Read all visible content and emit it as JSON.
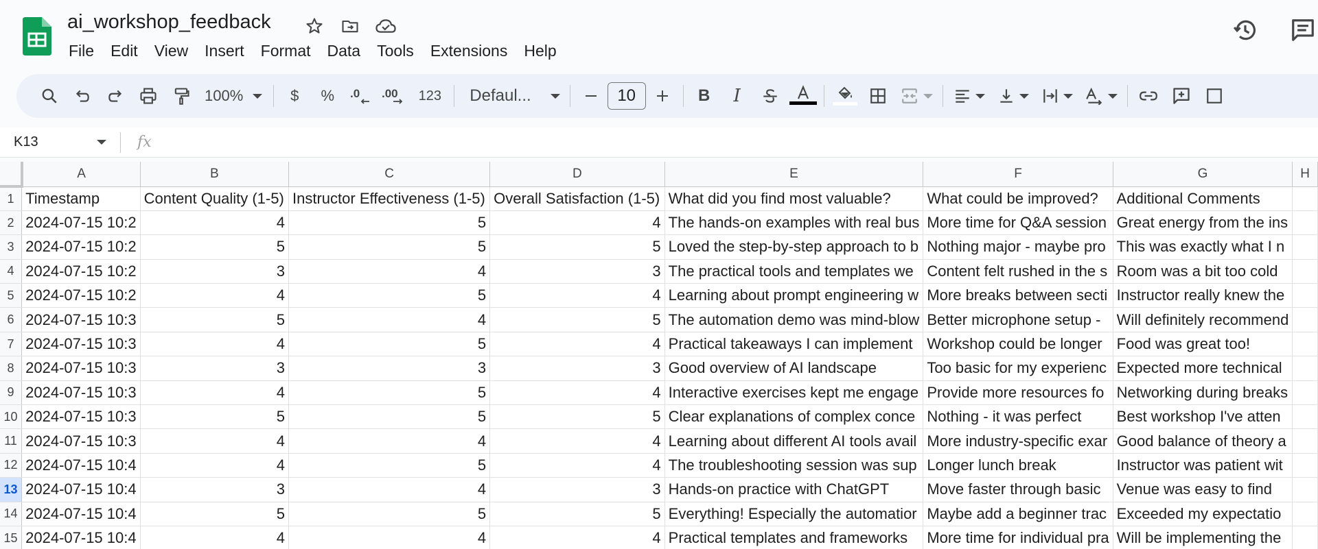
{
  "document": {
    "title": "ai_workshop_feedback"
  },
  "menu": [
    "File",
    "Edit",
    "View",
    "Insert",
    "Format",
    "Data",
    "Tools",
    "Extensions",
    "Help"
  ],
  "toolbar": {
    "zoom": "100%",
    "currency": "$",
    "percent": "%",
    "dec_decrease": ".0",
    "dec_increase": ".00",
    "number_format": "123",
    "font": "Defaul...",
    "font_size": "10",
    "bold": "B",
    "italic": "I"
  },
  "formula_bar": {
    "cell_ref": "K13",
    "fx": "fx",
    "value": ""
  },
  "sheet": {
    "columns": [
      "A",
      "B",
      "C",
      "D",
      "E",
      "F",
      "G",
      "H"
    ],
    "rows": [
      {
        "n": "1",
        "cells": [
          "Timestamp",
          "Content Quality (1-5)",
          "Instructor Effectiveness (1-5)",
          "Overall Satisfaction (1-5)",
          "What did you find most valuable?",
          "What could be improved?",
          "Additional Comments",
          ""
        ]
      },
      {
        "n": "2",
        "cells": [
          "2024-07-15 10:2",
          "4",
          "5",
          "4",
          "The hands-on examples with real bus",
          "More time for Q&A session",
          "Great energy from the ins",
          ""
        ]
      },
      {
        "n": "3",
        "cells": [
          "2024-07-15 10:2",
          "5",
          "5",
          "5",
          "Loved the step-by-step approach to b",
          "Nothing major - maybe pro",
          "This was exactly what I n",
          ""
        ]
      },
      {
        "n": "4",
        "cells": [
          "2024-07-15 10:2",
          "3",
          "4",
          "3",
          "The practical tools and templates we",
          "Content felt rushed in the s",
          "Room was a bit too cold",
          ""
        ]
      },
      {
        "n": "5",
        "cells": [
          "2024-07-15 10:2",
          "4",
          "5",
          "4",
          "Learning about prompt engineering w",
          "More breaks between secti",
          "Instructor really knew the",
          ""
        ]
      },
      {
        "n": "6",
        "cells": [
          "2024-07-15 10:3",
          "5",
          "4",
          "5",
          "The automation demo was mind-blow",
          "Better microphone setup -",
          "Will definitely recommend",
          ""
        ]
      },
      {
        "n": "7",
        "cells": [
          "2024-07-15 10:3",
          "4",
          "5",
          "4",
          "Practical takeaways I can implement",
          "Workshop could be longer",
          "Food was great too!",
          ""
        ]
      },
      {
        "n": "8",
        "cells": [
          "2024-07-15 10:3",
          "3",
          "3",
          "3",
          "Good overview of AI landscape",
          "Too basic for my experienc",
          "Expected more technical",
          ""
        ]
      },
      {
        "n": "9",
        "cells": [
          "2024-07-15 10:3",
          "4",
          "5",
          "4",
          "Interactive exercises kept me engage",
          "Provide more resources fo",
          "Networking during breaks",
          ""
        ]
      },
      {
        "n": "10",
        "cells": [
          "2024-07-15 10:3",
          "5",
          "5",
          "5",
          "Clear explanations of complex conce",
          "Nothing - it was perfect",
          "Best workshop I've atten",
          ""
        ]
      },
      {
        "n": "11",
        "cells": [
          "2024-07-15 10:3",
          "4",
          "4",
          "4",
          "Learning about different AI tools avail",
          "More industry-specific exar",
          "Good balance of theory a",
          ""
        ]
      },
      {
        "n": "12",
        "cells": [
          "2024-07-15 10:4",
          "4",
          "5",
          "4",
          "The troubleshooting session was sup",
          "Longer lunch break",
          "Instructor was patient wit",
          ""
        ]
      },
      {
        "n": "13",
        "cells": [
          "2024-07-15 10:4",
          "3",
          "4",
          "3",
          "Hands-on practice with ChatGPT",
          "Move faster through basic",
          "Venue was easy to find",
          ""
        ]
      },
      {
        "n": "14",
        "cells": [
          "2024-07-15 10:4",
          "5",
          "5",
          "5",
          "Everything! Especially the automatior",
          "Maybe add a beginner trac",
          "Exceeded my expectatio",
          ""
        ]
      },
      {
        "n": "15",
        "cells": [
          "2024-07-15 10:4",
          "4",
          "4",
          "4",
          "Practical templates and frameworks",
          "More time for individual pra",
          "Will be implementing the",
          ""
        ]
      }
    ],
    "active_row": "13"
  },
  "colors": {
    "sheets_green": "#0f9d58",
    "toolbar_bg": "#edf2fa",
    "active_row_bg": "#d3e3fd",
    "active_row_text": "#0b57d0"
  }
}
